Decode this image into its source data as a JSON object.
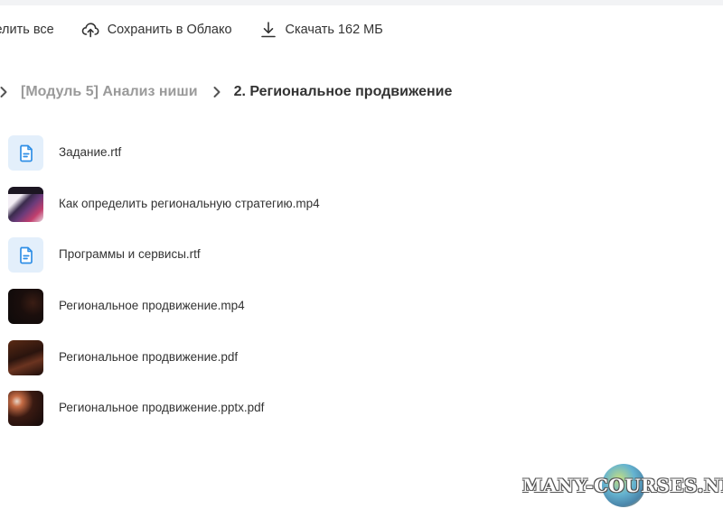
{
  "toolbar": {
    "select_all_label": "делить все",
    "save_cloud_label": "Сохранить в Облако",
    "download_label": "Скачать 162 МБ"
  },
  "breadcrumb": {
    "parent": "[Модуль 5] Анализ ниши",
    "current": "2. Региональное продвижение"
  },
  "files": [
    {
      "name": "Задание.rtf",
      "icon": "document-icon"
    },
    {
      "name": "Как определить региональную стратегию.mp4",
      "icon": "video-thumbnail"
    },
    {
      "name": "Программы и сервисы.rtf",
      "icon": "document-icon"
    },
    {
      "name": "Региональное продвижение.mp4",
      "icon": "video-thumbnail"
    },
    {
      "name": "Региональное продвижение.pdf",
      "icon": "pdf-thumbnail"
    },
    {
      "name": "Региональное продвижение.pptx.pdf",
      "icon": "pdf-thumbnail"
    }
  ],
  "watermark": {
    "text": "MANY-COURSES.NET"
  },
  "colors": {
    "accent": "#2f8fe6",
    "doc_bg": "#e3effb",
    "text": "#333333",
    "muted": "#9a9a9a"
  }
}
